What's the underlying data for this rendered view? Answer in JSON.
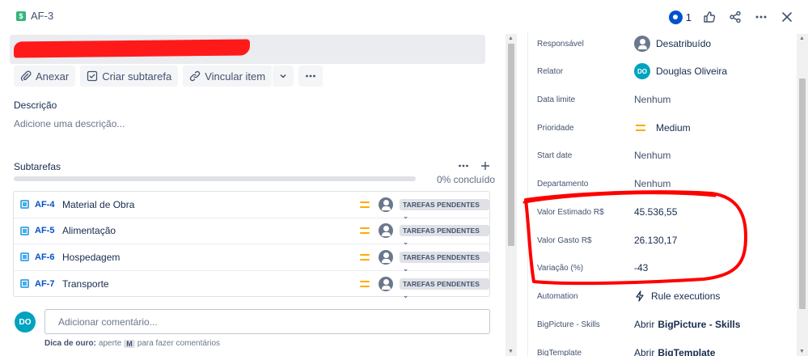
{
  "header": {
    "issue_key": "AF-3",
    "watch_count": "1"
  },
  "toolbar": {
    "attach": "Anexar",
    "create_subtask": "Criar subtarefa",
    "link_item": "Vincular item"
  },
  "description": {
    "label": "Descrição",
    "placeholder": "Adicione uma descrição..."
  },
  "subtasks": {
    "label": "Subtarefas",
    "progress_label": "0% concluído",
    "progress": 0,
    "items": [
      {
        "key": "AF-4",
        "summary": "Material de Obra",
        "status": "TAREFAS PENDENTES"
      },
      {
        "key": "AF-5",
        "summary": "Alimentação",
        "status": "TAREFAS PENDENTES"
      },
      {
        "key": "AF-6",
        "summary": "Hospedagem",
        "status": "TAREFAS PENDENTES"
      },
      {
        "key": "AF-7",
        "summary": "Transporte",
        "status": "TAREFAS PENDENTES"
      }
    ]
  },
  "comment": {
    "avatar_initials": "DO",
    "placeholder": "Adicionar comentário...",
    "tip_prefix": "Dica de ouro:",
    "tip_middle": "aperte",
    "tip_key": "M",
    "tip_suffix": "para fazer comentários"
  },
  "fields": {
    "assignee": {
      "label": "Responsável",
      "value": "Desatribuído"
    },
    "reporter": {
      "label": "Relator",
      "value": "Douglas Oliveira",
      "initials": "DO"
    },
    "due_date": {
      "label": "Data limite",
      "value": "Nenhum"
    },
    "priority": {
      "label": "Prioridade",
      "value": "Medium"
    },
    "start_date": {
      "label": "Start date",
      "value": "Nenhum"
    },
    "department": {
      "label": "Departamento",
      "value": "Nenhum"
    },
    "estimated": {
      "label": "Valor Estimado R$",
      "value": "45.536,55"
    },
    "spent": {
      "label": "Valor Gasto R$",
      "value": "26.130,17"
    },
    "variation": {
      "label": "Variação (%)",
      "value": "-43"
    },
    "automation": {
      "label": "Automation",
      "value": "Rule executions"
    },
    "bigpicture": {
      "label": "BigPicture - Skills",
      "value_prefix": "Abrir",
      "value_bold": "BigPicture - Skills"
    },
    "bigtemplate": {
      "label": "BigTemplate",
      "value_prefix": "Abrir",
      "value_bold": "BigTemplate"
    }
  },
  "colors": {
    "accent": "#0052cc",
    "priority_medium": "#ffab00",
    "annotation": "#ff0000",
    "redaction": "#ff1a1a"
  }
}
